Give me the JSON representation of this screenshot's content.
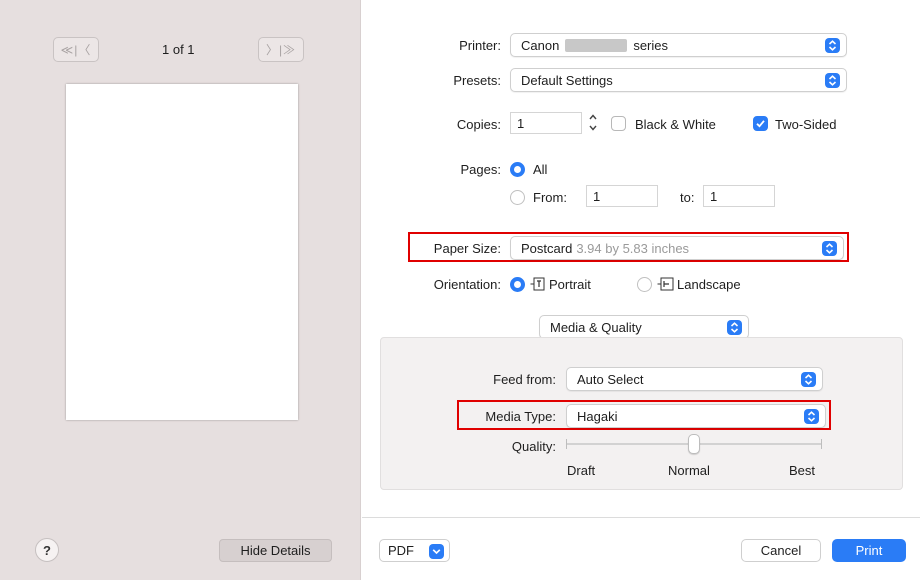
{
  "preview": {
    "first_prev_glyph": "≪|〈",
    "next_last_glyph": "〉|≫",
    "page_counter": "1 of 1",
    "help_glyph": "?",
    "hide_details_label": "Hide Details"
  },
  "printer": {
    "label": "Printer:",
    "value_prefix": "Canon",
    "value_suffix": "series"
  },
  "presets": {
    "label": "Presets:",
    "value": "Default Settings"
  },
  "copies": {
    "label": "Copies:",
    "value": "1",
    "black_white_label": "Black & White",
    "black_white_checked": false,
    "two_sided_label": "Two-Sided",
    "two_sided_checked": true
  },
  "pages": {
    "label": "Pages:",
    "all_label": "All",
    "all_selected": true,
    "from_label": "From:",
    "from_value": "1",
    "to_label": "to:",
    "to_value": "1"
  },
  "paper_size": {
    "label": "Paper Size:",
    "value": "Postcard",
    "detail": "3.94 by 5.83 inches"
  },
  "orientation": {
    "label": "Orientation:",
    "portrait_label": "Portrait",
    "portrait_selected": true,
    "landscape_label": "Landscape"
  },
  "section_popup": {
    "value": "Media & Quality"
  },
  "feed_from": {
    "label": "Feed from:",
    "value": "Auto Select"
  },
  "media_type": {
    "label": "Media Type:",
    "value": "Hagaki"
  },
  "quality": {
    "label": "Quality:",
    "ticks": [
      "Draft",
      "Normal",
      "Best"
    ],
    "selected": "Normal"
  },
  "footer": {
    "pdf_label": "PDF",
    "cancel_label": "Cancel",
    "print_label": "Print"
  },
  "colors": {
    "accent": "#2a7cf6",
    "highlight": "#e00000",
    "preview_bg": "#e6dfdf"
  }
}
